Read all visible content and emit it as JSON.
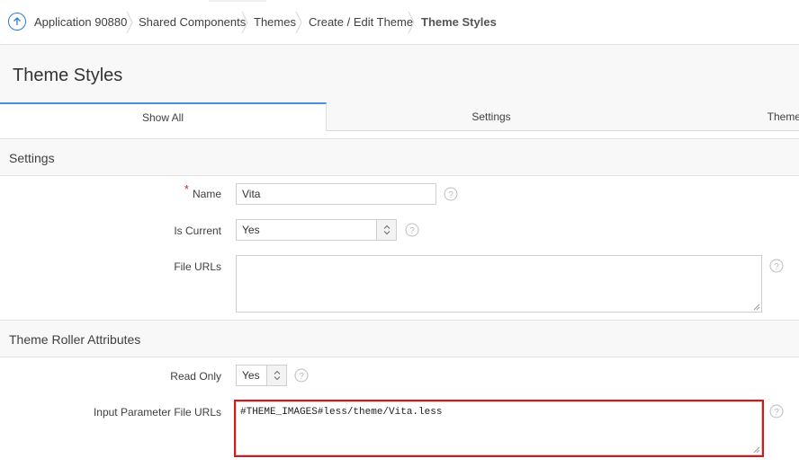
{
  "breadcrumb": {
    "items": [
      {
        "label": "Application 90880"
      },
      {
        "label": "Shared Components"
      },
      {
        "label": "Themes"
      },
      {
        "label": "Create / Edit Theme"
      },
      {
        "label": "Theme Styles"
      }
    ]
  },
  "page": {
    "title": "Theme Styles"
  },
  "tabs": [
    {
      "label": "Show All"
    },
    {
      "label": "Settings"
    },
    {
      "label": "Theme"
    }
  ],
  "settings": {
    "title": "Settings",
    "name": {
      "label": "Name",
      "value": "Vita",
      "required_mark": "*"
    },
    "is_current": {
      "label": "Is Current",
      "value": "Yes"
    },
    "file_urls": {
      "label": "File URLs",
      "value": ""
    }
  },
  "theme_roller": {
    "title": "Theme Roller Attributes",
    "read_only": {
      "label": "Read Only",
      "value": "Yes"
    },
    "input_param": {
      "label": "Input Parameter File URLs",
      "value": "#THEME_IMAGES#less/theme/Vita.less"
    }
  },
  "colors": {
    "accent": "#4d8ed9",
    "highlight": "#d11a1a",
    "required": "#e02020"
  }
}
